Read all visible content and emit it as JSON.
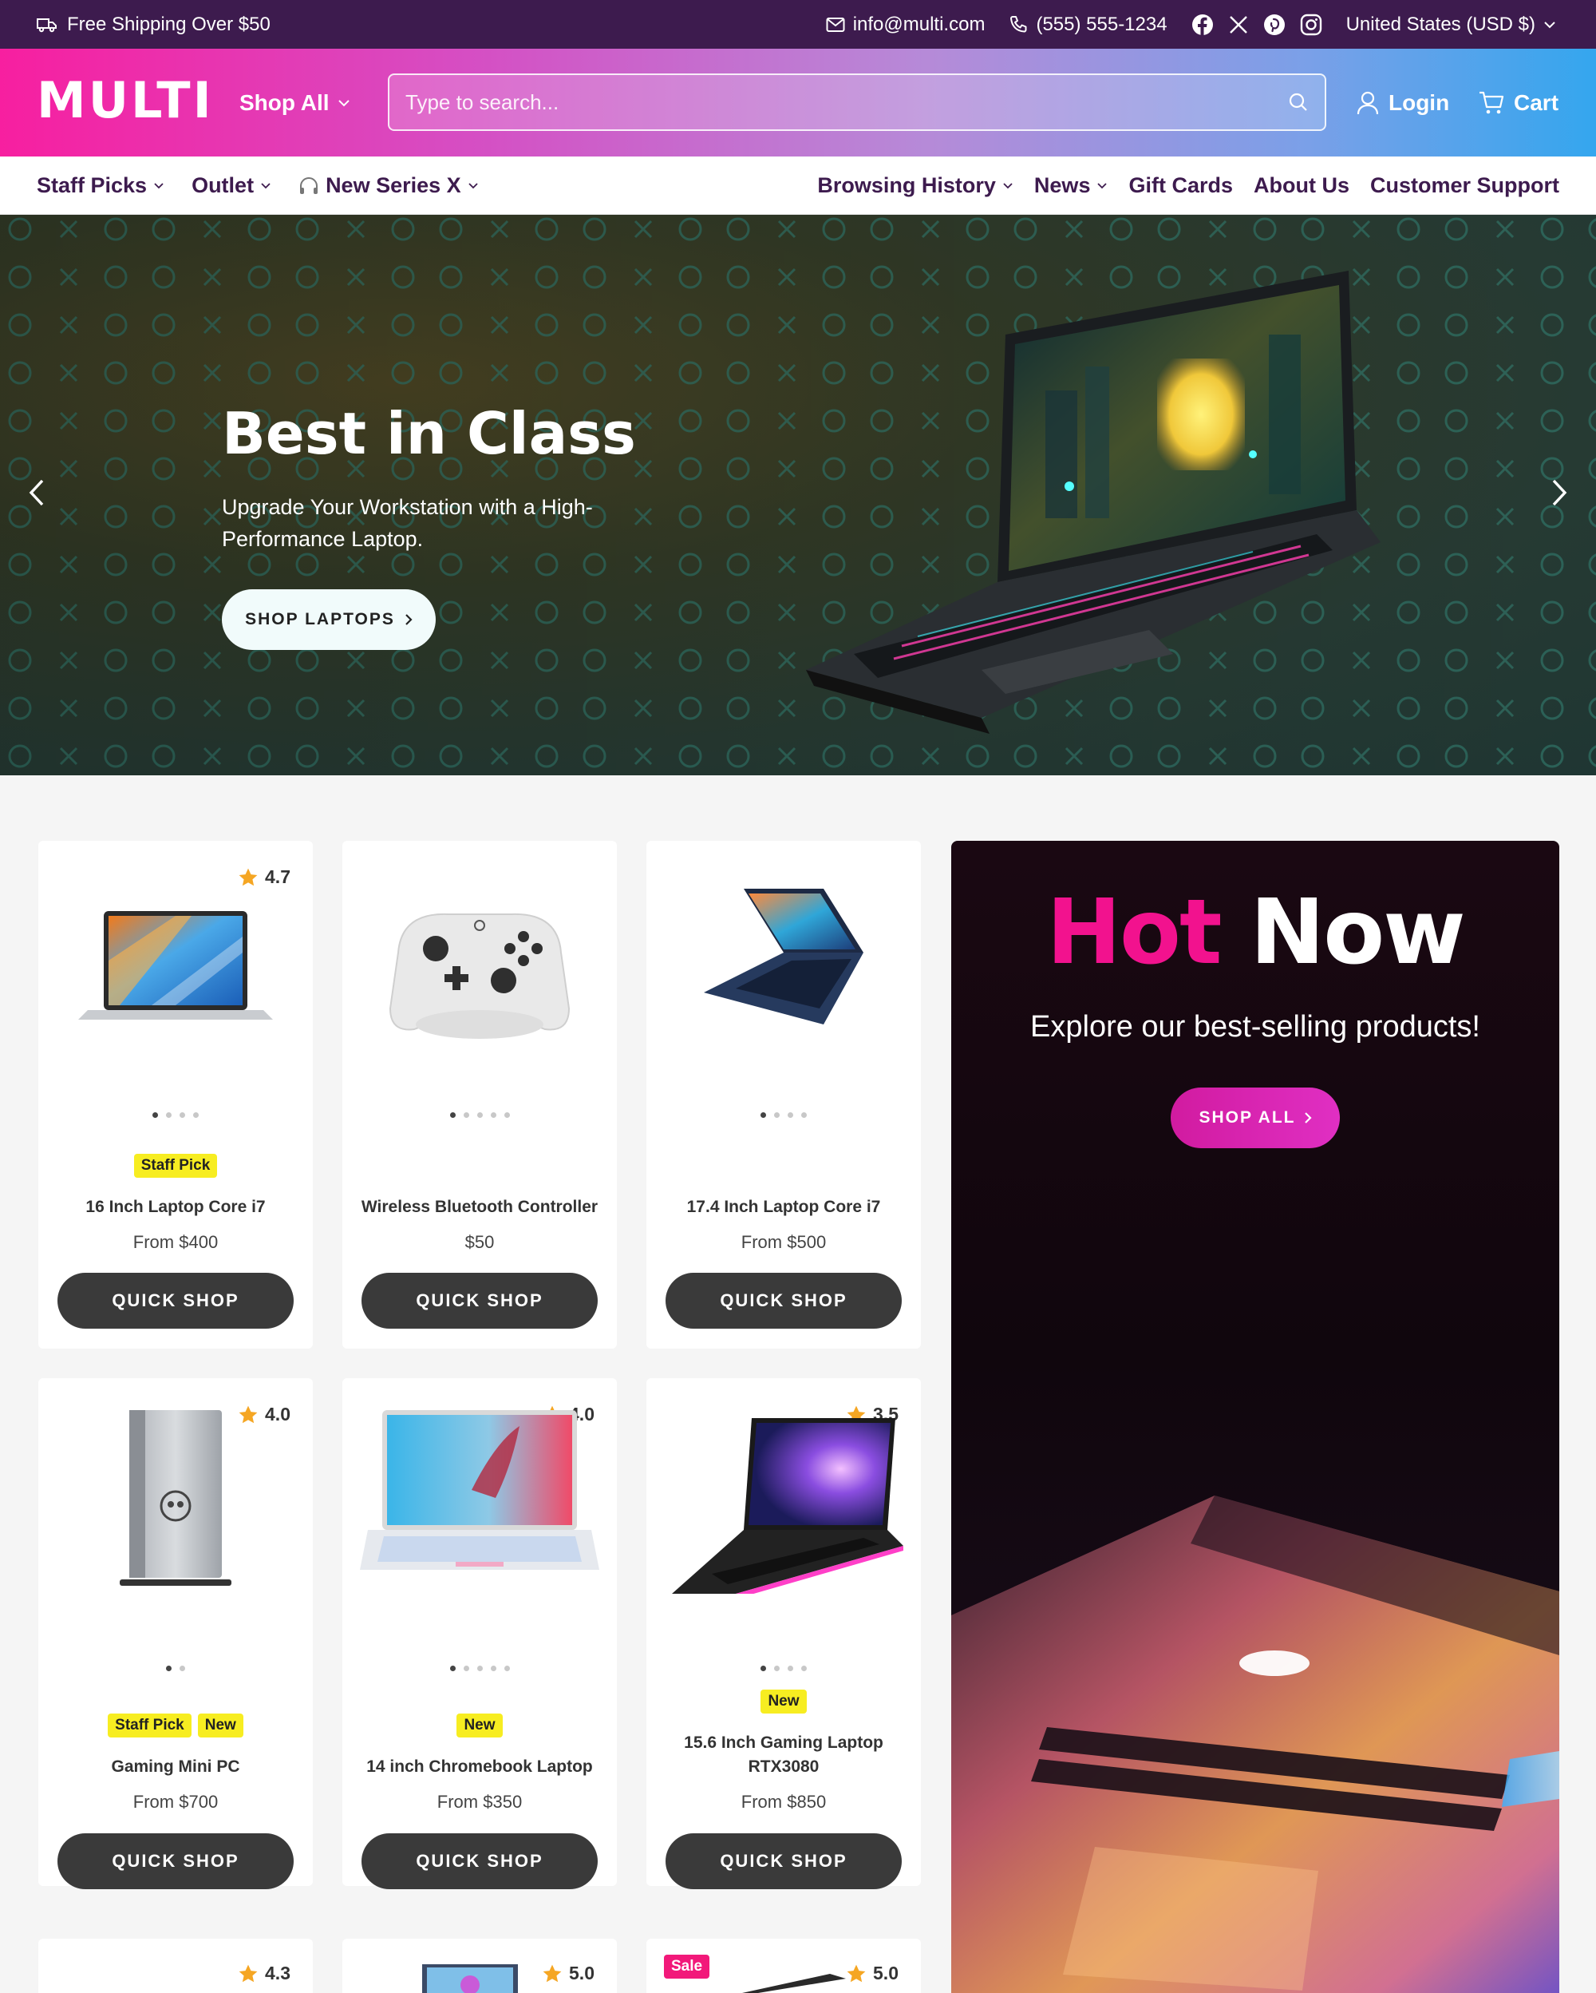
{
  "topbar": {
    "shipping": "Free Shipping Over $50",
    "email": "info@multi.com",
    "phone": "(555) 555-1234",
    "socials": [
      "facebook-icon",
      "x-icon",
      "pinterest-icon",
      "instagram-icon"
    ],
    "region": "United States (USD $)"
  },
  "header": {
    "logo": "MULTI",
    "shop_all": "Shop All",
    "search_placeholder": "Type to search...",
    "login": "Login",
    "cart": "Cart"
  },
  "nav": {
    "left": [
      {
        "label": "Staff Picks",
        "dropdown": true
      },
      {
        "label": "Outlet",
        "dropdown": true
      },
      {
        "label": "New Series X",
        "dropdown": true,
        "icon": "headphones-icon"
      }
    ],
    "right": [
      {
        "label": "Browsing History",
        "dropdown": true
      },
      {
        "label": "News",
        "dropdown": true
      },
      {
        "label": "Gift Cards",
        "dropdown": false
      },
      {
        "label": "About Us",
        "dropdown": false
      },
      {
        "label": "Customer Support",
        "dropdown": false
      }
    ]
  },
  "hero": {
    "title": "Best in Class",
    "subtitle": "Upgrade Your Workstation with a High-Performance Laptop.",
    "button": "SHOP LAPTOPS"
  },
  "products": [
    {
      "name": "16 Inch Laptop Core i7",
      "price": "From $400",
      "rating": "4.7",
      "badges": [
        "Staff Pick"
      ],
      "dots": 4,
      "image": "laptop-silver"
    },
    {
      "name": "Wireless Bluetooth Controller",
      "price": "$50",
      "rating": "",
      "badges": [],
      "dots": 5,
      "image": "controller"
    },
    {
      "name": "17.4 Inch Laptop Core i7",
      "price": "From $500",
      "rating": "",
      "badges": [],
      "dots": 4,
      "image": "laptop-navy"
    },
    {
      "name": "Gaming Mini PC",
      "price": "From $700",
      "rating": "4.0",
      "badges": [
        "Staff Pick",
        "New"
      ],
      "dots": 2,
      "image": "mini-pc"
    },
    {
      "name": "14 inch Chromebook Laptop",
      "price": "From $350",
      "rating": "4.0",
      "badges": [
        "New"
      ],
      "dots": 5,
      "image": "chromebook"
    },
    {
      "name": "15.6 Inch Gaming Laptop RTX3080",
      "price": "From $850",
      "rating": "3.5",
      "badges": [
        "New"
      ],
      "dots": 4,
      "image": "gaming-laptop"
    },
    {
      "name": "",
      "price": "",
      "rating": "4.3",
      "badges": [],
      "dots": 0,
      "image": ""
    },
    {
      "name": "",
      "price": "",
      "rating": "5.0",
      "badges": [],
      "dots": 0,
      "image": "pc-case"
    },
    {
      "name": "",
      "price": "",
      "rating": "5.0",
      "badges": [
        "Sale"
      ],
      "dots": 0,
      "image": "laptop-dark"
    }
  ],
  "quick_shop": "QUICK SHOP",
  "promo": {
    "title_a": "Hot",
    "title_b": "Now",
    "subtitle": "Explore our best-selling products!",
    "button": "SHOP ALL"
  },
  "colors": {
    "topbar": "#3d1b4e",
    "accent_pink": "#f2128e",
    "badge_yellow": "#f7ed21",
    "star": "#f5a623",
    "button_dark": "#3a3a3a"
  }
}
